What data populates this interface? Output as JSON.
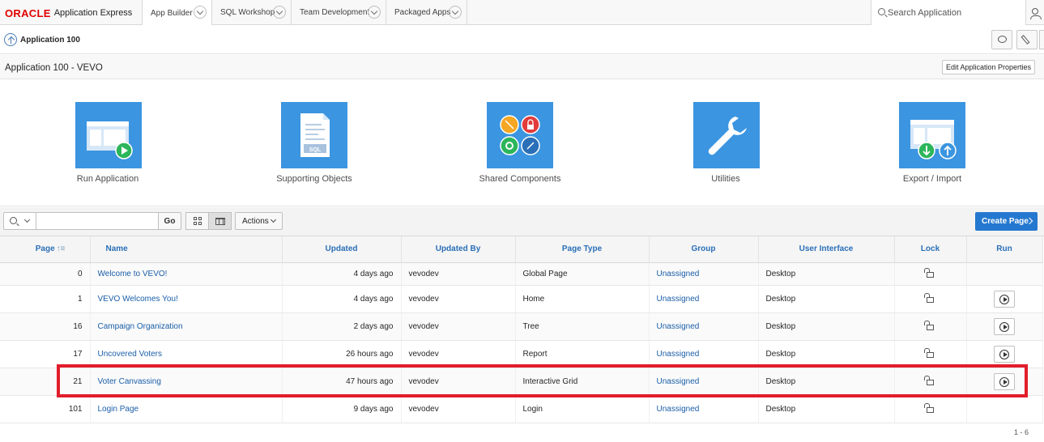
{
  "topnav": {
    "brand_oracle": "ORACLE",
    "brand_product": "Application Express",
    "tabs": [
      {
        "label": "App Builder",
        "active": true
      },
      {
        "label": "SQL Workshop",
        "active": false
      },
      {
        "label": "Team Development",
        "active": false
      },
      {
        "label": "Packaged Apps",
        "active": false
      }
    ],
    "search_placeholder": "Search Application"
  },
  "breadcrumb": {
    "label": "Application 100"
  },
  "region": {
    "title": "Application 100 - VEVO",
    "edit_button": "Edit Application Properties"
  },
  "tiles": [
    {
      "label": "Run Application",
      "icon": "run-application-icon"
    },
    {
      "label": "Supporting Objects",
      "icon": "supporting-objects-icon"
    },
    {
      "label": "Shared Components",
      "icon": "shared-components-icon"
    },
    {
      "label": "Utilities",
      "icon": "utilities-icon"
    },
    {
      "label": "Export / Import",
      "icon": "export-import-icon"
    }
  ],
  "toolbar": {
    "search_value": "",
    "go_label": "Go",
    "actions_label": "Actions",
    "create_label": "Create Page"
  },
  "table": {
    "columns": [
      "Page",
      "Name",
      "Updated",
      "Updated By",
      "Page Type",
      "Group",
      "User Interface",
      "Lock",
      "Run"
    ],
    "rows": [
      {
        "page": "0",
        "name": "Welcome to VEVO!",
        "updated": "4 days ago",
        "by": "vevodev",
        "type": "Global Page",
        "group": "Unassigned",
        "ui": "Desktop",
        "run": false
      },
      {
        "page": "1",
        "name": "VEVO Welcomes You!",
        "updated": "4 days ago",
        "by": "vevodev",
        "type": "Home",
        "group": "Unassigned",
        "ui": "Desktop",
        "run": true
      },
      {
        "page": "16",
        "name": "Campaign Organization",
        "updated": "2 days ago",
        "by": "vevodev",
        "type": "Tree",
        "group": "Unassigned",
        "ui": "Desktop",
        "run": true
      },
      {
        "page": "17",
        "name": "Uncovered Voters",
        "updated": "26 hours ago",
        "by": "vevodev",
        "type": "Report",
        "group": "Unassigned",
        "ui": "Desktop",
        "run": true
      },
      {
        "page": "21",
        "name": "Voter Canvassing",
        "updated": "47 hours ago",
        "by": "vevodev",
        "type": "Interactive Grid",
        "group": "Unassigned",
        "ui": "Desktop",
        "run": true
      },
      {
        "page": "101",
        "name": "Login Page",
        "updated": "9 days ago",
        "by": "vevodev",
        "type": "Login",
        "group": "Unassigned",
        "ui": "Desktop",
        "run": false
      }
    ]
  },
  "pagination": "1 - 6",
  "colors": {
    "accent": "#2578cf",
    "tile": "#3b95e0",
    "highlight": "#e21d2b",
    "brand_red": "#e00000"
  }
}
